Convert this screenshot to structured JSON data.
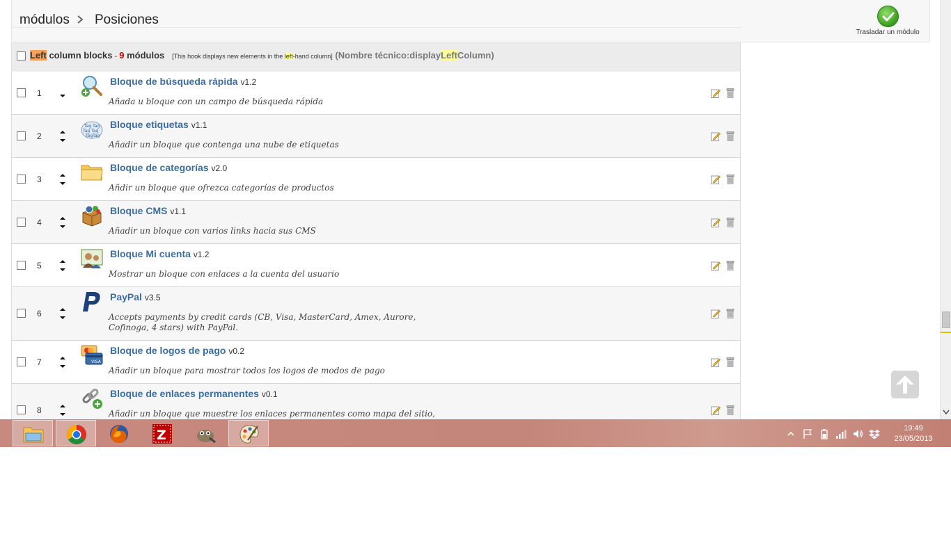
{
  "breadcrumb": {
    "parent": "módulos",
    "separator": ">",
    "current": "Posiciones"
  },
  "toolbar": {
    "move_label": "Trasladar un módulo"
  },
  "hook": {
    "name_highlight": "Left",
    "name_rest": " column blocks",
    "dash": " - ",
    "count": "9",
    "count_label": " módulos",
    "desc_prefix": "[This hook displays new elements in the ",
    "desc_highlight": "left",
    "desc_suffix": "-hand column]",
    "tech_prefix": "(Nombre técnico:display",
    "tech_highlight": "Left",
    "tech_suffix": "Column)"
  },
  "modules": [
    {
      "position": "1",
      "name": "Bloque de búsqueda rápida",
      "version": "v1.2",
      "description": "Añada u bloque con un campo de búsqueda rápida",
      "icon": "search-add-icon"
    },
    {
      "position": "2",
      "name": "Bloque etiquetas",
      "version": "v1.1",
      "description": "Añadir un bloque que contenga una nube de etiquetas",
      "icon": "tag-cloud-icon"
    },
    {
      "position": "3",
      "name": "Bloque de categorías",
      "version": "v2.0",
      "description": "Añdir un bloque que ofrezca categorías de productos",
      "icon": "folder-icon"
    },
    {
      "position": "4",
      "name": "Bloque CMS",
      "version": "v1.1",
      "description": "Añadir un bloque con varios links hacia sus CMS",
      "icon": "cms-box-icon"
    },
    {
      "position": "5",
      "name": "Bloque Mi cuenta",
      "version": "v1.2",
      "description": "Mostrar un bloque con enlaces a la cuenta del usuario",
      "icon": "account-icon"
    },
    {
      "position": "6",
      "name": "PayPal",
      "version": "v3.5",
      "description": "Accepts payments by credit cards (CB, Visa, MasterCard, Amex, Aurore, Cofinoga, 4 stars) with PayPal.",
      "icon": "paypal-icon"
    },
    {
      "position": "7",
      "name": "Bloque de logos de pago",
      "version": "v0.2",
      "description": "Añadir un bloque para mostrar todos los logos de modos de pago",
      "icon": "payment-logos-icon"
    },
    {
      "position": "8",
      "name": "Bloque de enlaces permanentes",
      "version": "v0.1",
      "description": "Añadir un bloque que muestre los enlaces permanentes como mapa del sitio,",
      "icon": "permalink-icon"
    }
  ],
  "taskbar": {
    "apps": [
      "file-explorer-icon",
      "chrome-icon",
      "firefox-icon",
      "filezilla-icon",
      "gimp-icon",
      "paint-icon"
    ],
    "clock_time": "19:49",
    "clock_date": "23/05/2013"
  },
  "colors": {
    "link": "#3a6ea5",
    "count": "#cc0000",
    "highlight_orange": "#f7a058",
    "highlight_yellow": "#fdfd9a",
    "taskbar": "#c4857a"
  }
}
